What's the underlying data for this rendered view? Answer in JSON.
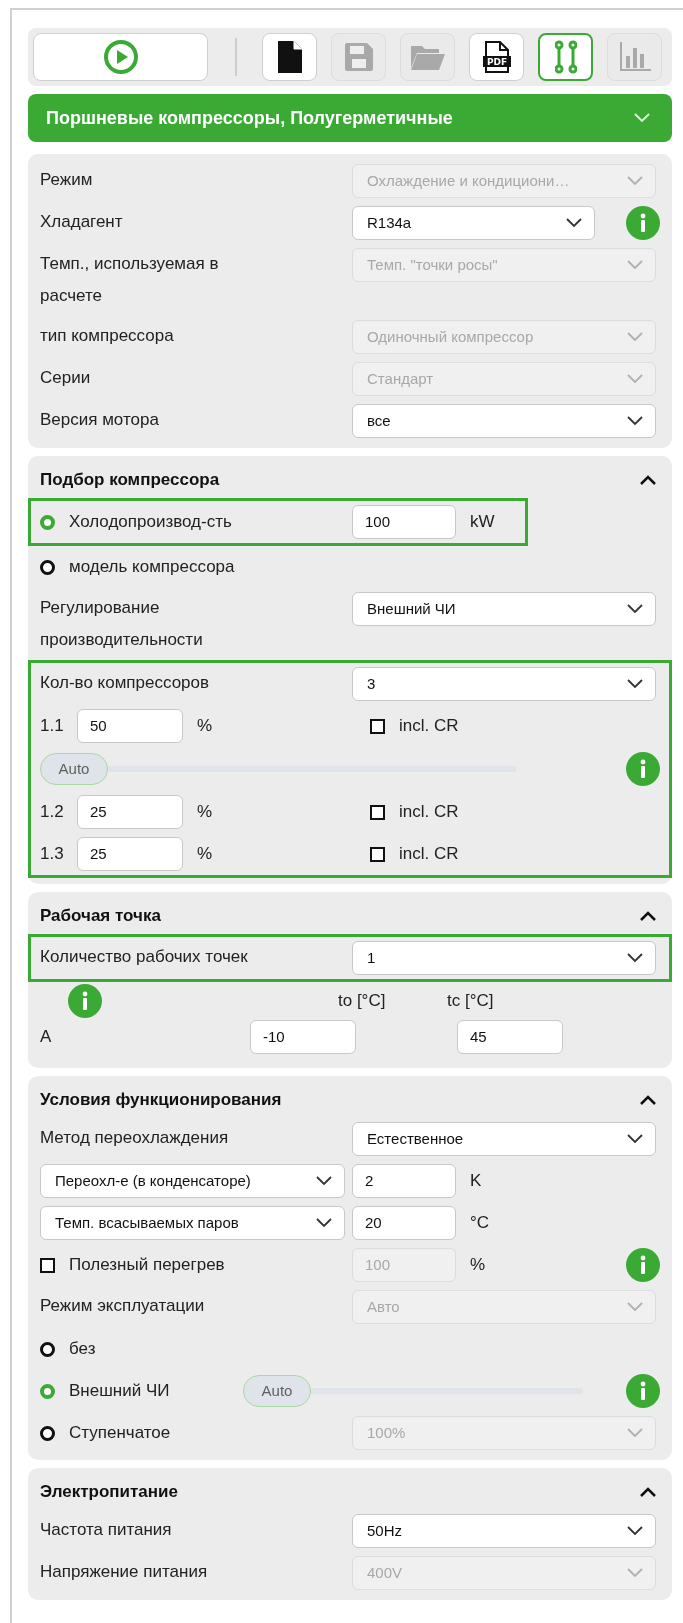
{
  "toolbar": {
    "run_button": {
      "disabled": false
    },
    "buttons": [
      {
        "kind": "new-file",
        "disabled": false,
        "selected": false
      },
      {
        "kind": "save",
        "disabled": true,
        "selected": false
      },
      {
        "kind": "folder",
        "disabled": true,
        "selected": false
      },
      {
        "kind": "pdf",
        "label": "PDF",
        "disabled": false,
        "selected": false
      },
      {
        "kind": "connect",
        "disabled": false,
        "selected": true
      },
      {
        "kind": "chart",
        "disabled": true,
        "selected": false
      }
    ]
  },
  "category": {
    "title": "Поршневые компрессоры, Полугерметичные"
  },
  "sections": [
    {
      "rows": [
        {
          "kind": "select",
          "label": "Режим",
          "value": "Охлаждение и кондициони…",
          "disabled": true
        },
        {
          "kind": "select",
          "label": "Хладагент",
          "value": "R134a",
          "disabled": false,
          "info": true
        },
        {
          "kind": "select",
          "label": "Темп., используемая в расчете",
          "value": "Темп. \"точки росы\"",
          "disabled": true
        },
        {
          "kind": "select",
          "label": "тип компрессора",
          "value": "Одиночный компрессор",
          "disabled": true
        },
        {
          "kind": "select",
          "label": "Серии",
          "value": "Стандарт",
          "disabled": true
        },
        {
          "kind": "select",
          "label": "Версия мотора",
          "value": "все",
          "disabled": false
        }
      ]
    },
    {
      "title": "Подбор компрессора",
      "expanded": true,
      "rows": [
        {
          "kind": "radio",
          "label": "Холодопроизвод-сть",
          "selected": true,
          "input": "100",
          "unit": "kW",
          "highlighted": true
        },
        {
          "kind": "radio",
          "label": "модель компрессора",
          "selected": false
        },
        {
          "kind": "select",
          "label": "Регулирование производительности",
          "value": "Внешний ЧИ",
          "disabled": false
        },
        {
          "kind": "group",
          "highlighted": true,
          "rows": [
            {
              "kind": "select",
              "label": "Кол-во компрессоров",
              "value": "3",
              "disabled": false
            },
            {
              "kind": "share",
              "label": "1.1",
              "input": "50",
              "unit": "%",
              "check_label": "incl. CR",
              "checked": false
            },
            {
              "kind": "slider",
              "thumb": "Auto",
              "level": 0,
              "info": true
            },
            {
              "kind": "share",
              "label": "1.2",
              "input": "25",
              "unit": "%",
              "check_label": "incl. CR",
              "checked": false
            },
            {
              "kind": "share",
              "label": "1.3",
              "input": "25",
              "unit": "%",
              "check_label": "incl. CR",
              "checked": false
            }
          ]
        }
      ]
    },
    {
      "title": "Рабочая точка",
      "expanded": true,
      "rows": [
        {
          "kind": "select",
          "label": "Количество рабочих точек",
          "value": "1",
          "disabled": false,
          "highlighted": true
        },
        {
          "kind": "point_header",
          "info": true,
          "columns": [
            "to [°C]",
            "tc [°C]"
          ]
        },
        {
          "kind": "point",
          "label": "A",
          "values": [
            "-10",
            "45"
          ]
        }
      ]
    },
    {
      "title": "Условия функционирования",
      "expanded": true,
      "rows": [
        {
          "kind": "select",
          "label": "Метод переохлаждения",
          "value": "Естественное",
          "disabled": false
        },
        {
          "kind": "select_input",
          "select": "Переохл-е (в конденсаторе)",
          "input": "2",
          "unit": "K"
        },
        {
          "kind": "select_input",
          "select": "Темп. всасываемых паров",
          "input": "20",
          "unit": "°C"
        },
        {
          "kind": "checkbox",
          "label": "Полезный перегрев",
          "checked": false,
          "input": "100",
          "input_disabled": true,
          "unit": "%",
          "info": true
        },
        {
          "kind": "select",
          "label": "Режим эксплуатации",
          "value": "Авто",
          "disabled": true
        },
        {
          "kind": "radio",
          "label": "без",
          "selected": false
        },
        {
          "kind": "radio",
          "label": "Внешний ЧИ",
          "selected": true,
          "thumb": "Auto",
          "level": 0,
          "info": true
        },
        {
          "kind": "radio",
          "label": "Ступенчатое",
          "selected": false,
          "value": "100%",
          "disabled": true
        }
      ]
    },
    {
      "title": "Электропитание",
      "expanded": true,
      "rows": [
        {
          "kind": "select",
          "label": "Частота питания",
          "value": "50Hz",
          "disabled": false
        },
        {
          "kind": "select",
          "label": "Напряжение питания",
          "value": "400V",
          "disabled": true
        }
      ]
    }
  ]
}
